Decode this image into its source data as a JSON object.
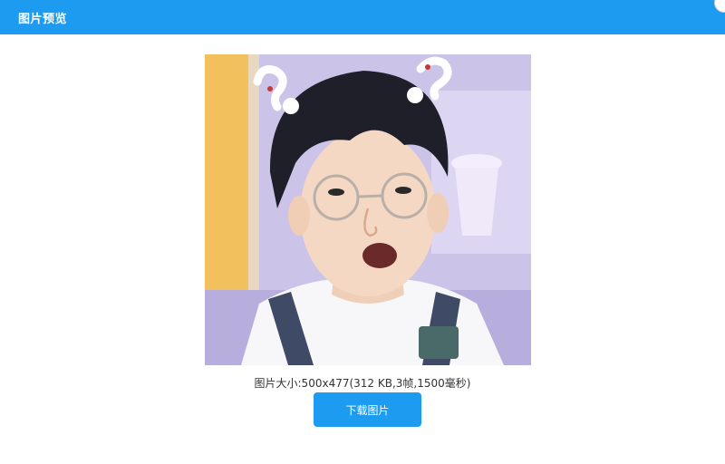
{
  "dialog": {
    "title": "图片预览",
    "image_info": "图片大小:500x477(312 KB,3帧,1500毫秒)",
    "download_label": "下载图片",
    "close_icon": "close-icon"
  },
  "colors": {
    "header": "#1d9bf0",
    "button": "#1d9bf0",
    "info_text": "#333333"
  },
  "background_tabs": [
    {
      "color": "#d9323a"
    },
    {
      "color": "#1f2f4a"
    },
    {
      "color": "#1a9e4a"
    }
  ]
}
